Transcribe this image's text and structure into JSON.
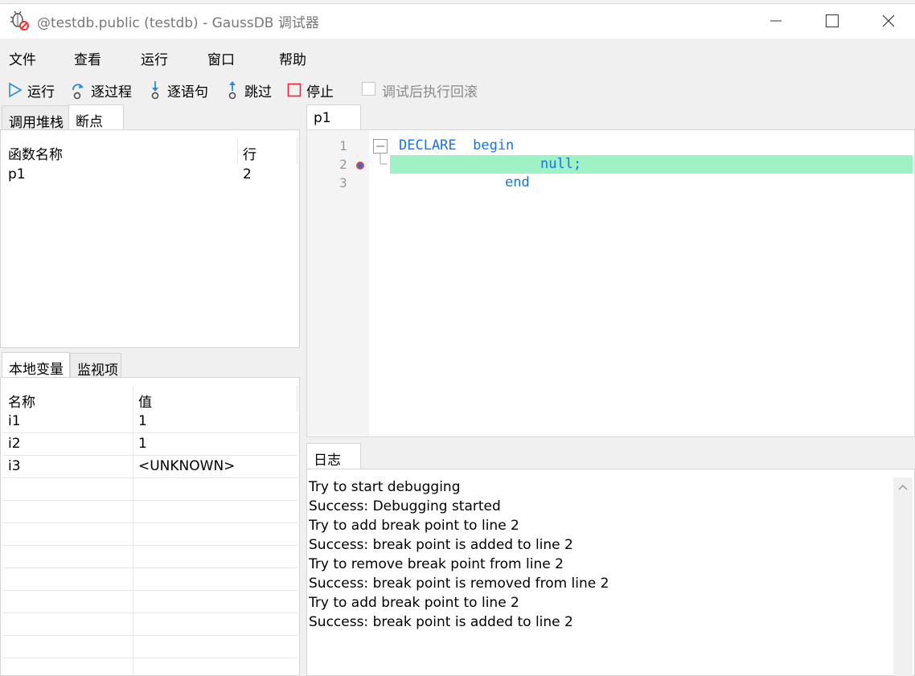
{
  "window": {
    "title": "@testdb.public (testdb) - GaussDB 调试器"
  },
  "menubar": [
    "文件",
    "查看",
    "运行",
    "窗口",
    "帮助"
  ],
  "toolbar": {
    "run": "运行",
    "step_over": "逐过程",
    "step_into": "逐语句",
    "step_out": "跳过",
    "stop": "停止",
    "rollback_label": "调试后执行回滚",
    "rollback_checked": false
  },
  "callstack_panel": {
    "tabs": [
      "调用堆栈",
      "断点"
    ],
    "active_tab": "断点",
    "columns": [
      "函数名称",
      "行"
    ],
    "rows": [
      [
        "p1",
        "2"
      ]
    ]
  },
  "variables_panel": {
    "tabs": [
      "本地变量",
      "监视项"
    ],
    "active_tab": "本地变量",
    "columns": [
      "名称",
      "值"
    ],
    "rows": [
      [
        "i1",
        "1"
      ],
      [
        "i2",
        "1"
      ],
      [
        "i3",
        "<UNKNOWN>"
      ]
    ]
  },
  "editor": {
    "tab": "p1",
    "line_numbers": [
      "1",
      "2",
      "3"
    ],
    "lines": [
      "DECLARE  begin",
      "null;",
      "end"
    ],
    "breakpoint_line": 2,
    "highlight_color": "#9ef2c4",
    "keyword_color": "#1a73e8"
  },
  "log_panel": {
    "tab": "日志",
    "lines": [
      "Try to start debugging",
      "Success: Debugging started",
      "Try to add break point to line 2",
      "Success: break point is added to line 2",
      "Try to remove break point from line 2",
      "Success: break point is removed from line 2",
      "Try to add break point to line 2",
      "Success: break point is added to line 2"
    ]
  }
}
